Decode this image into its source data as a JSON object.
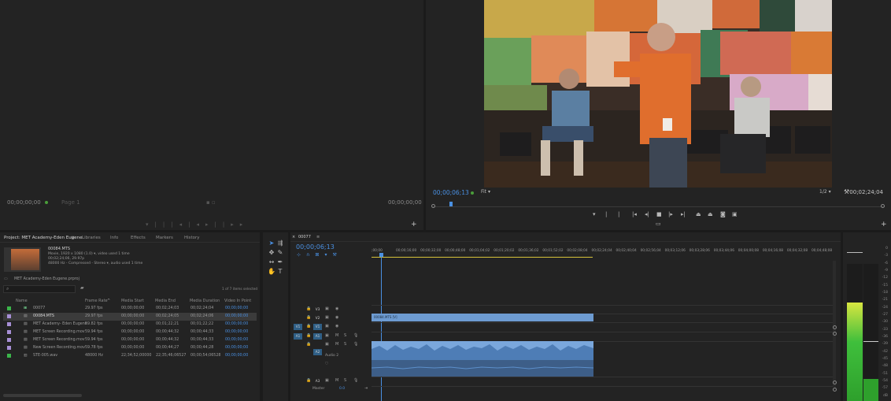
{
  "source_monitor": {
    "timecode_left": "00;00;00;00",
    "timecode_right": "00;00;00;00",
    "page_label": "Page 1"
  },
  "program_monitor": {
    "timecode": "00;00;06;13",
    "fit": "Fit",
    "quality": "1/2",
    "duration": "00;02;24;04"
  },
  "project_panel": {
    "title": "Project: MET Academy-Eden Eugene",
    "tabs": [
      "Libraries",
      "Info",
      "Effects",
      "Markers",
      "History"
    ],
    "preview": {
      "name": "00084.MTS",
      "line1": "Movie, 1920 x 1080 (1.0) ▾, video used 1 time",
      "line2": "00;02;24;06, 29.97p",
      "line3": "48000 Hz - Compressed - Stereo ▾, audio used 1 time"
    },
    "project_file": "MET Academy-Eden Eugene.prproj",
    "selection_count": "1 of 7 items selected",
    "columns": [
      "Name",
      "Frame Rate",
      "Media Start",
      "Media End",
      "Media Duration",
      "Video In Point"
    ],
    "rows": [
      {
        "name": "00077",
        "fps": "29.97 fps",
        "start": "00;00;00;00",
        "end": "00;02;24;03",
        "dur": "00;02;24;04",
        "in": "00;00;00;00",
        "color": "#3bb54a"
      },
      {
        "name": "00084.MTS",
        "fps": "29.97 fps",
        "start": "00;00;00;00",
        "end": "00;02;24;05",
        "dur": "00;02;24;06",
        "in": "00;00;00;00",
        "color": "#a78fd6"
      },
      {
        "name": "MET Academy- Eden Eugene",
        "fps": "59.82 fps",
        "start": "00;00;00;00",
        "end": "00;01;22;21",
        "dur": "00;01;22;22",
        "in": "00;00;00;00",
        "color": "#a78fd6"
      },
      {
        "name": "MET Screen Recording.mov",
        "fps": "59.94 fps",
        "start": "00;00;00;00",
        "end": "00;00;44;32",
        "dur": "00;00;44;33",
        "in": "00;00;00;00",
        "color": "#a78fd6"
      },
      {
        "name": "MET Screen Recording.mov",
        "fps": "59.94 fps",
        "start": "00;00;00;00",
        "end": "00;00;44;32",
        "dur": "00;00;44;33",
        "in": "00;00;00;00",
        "color": "#a78fd6"
      },
      {
        "name": "New Screen Recording.mov",
        "fps": "59.78 fps",
        "start": "00;00;00;00",
        "end": "00;00;44;27",
        "dur": "00;00;44;28",
        "in": "00;00;00;00",
        "color": "#a78fd6"
      },
      {
        "name": "STE-005.wav",
        "fps": "48000 Hz",
        "start": "22;34;52;00000",
        "end": "22;35;46;06527",
        "dur": "00;00;54;06528",
        "in": "00;00;00;00",
        "color": "#3bb54a"
      }
    ]
  },
  "timeline": {
    "sequence_name": "00077",
    "timecode": "00;00;06;13",
    "ruler": [
      ";00;00",
      "00;00;16;00",
      "00;00;32;00",
      "00;00;48;00",
      "00;01;04;02",
      "00;01;20;02",
      "00;01;36;02",
      "00;01;52;02",
      "00;02;08;04",
      "00;02;24;04",
      "00;02;40;04",
      "00;02;56;04",
      "00;03;12;06",
      "00;03;28;06",
      "00;03;44;06",
      "00;04;00;08",
      "00;04;16;08",
      "00;04;32;08",
      "00;04;48;08"
    ],
    "tracks_video": [
      "V3",
      "V2",
      "V1"
    ],
    "tracks_audio": [
      "A1",
      "A2",
      "A3"
    ],
    "src_video": "V1",
    "src_audio": "A1",
    "video_clip": "00084.MTS [V]",
    "audio_track_name": "Audio 2",
    "audio_vol": "0.0",
    "master_label": "Master",
    "master_value": "0.0",
    "mute": "M",
    "solo": "S"
  },
  "meter": {
    "db_scale": [
      "0",
      "-3",
      "-6",
      "-9",
      "-12",
      "-15",
      "-18",
      "-21",
      "-24",
      "-27",
      "-30",
      "-33",
      "-36",
      "-39",
      "-42",
      "-45",
      "-48",
      "-51",
      "-54",
      "-57",
      "dB"
    ],
    "left_level": 0.72,
    "right_level": 0.16
  },
  "colors": {
    "accent": "#4a90e2",
    "clip_video": "#6d9bd1",
    "clip_audio": "#7aa7dc",
    "playhead": "#4a90e2"
  }
}
